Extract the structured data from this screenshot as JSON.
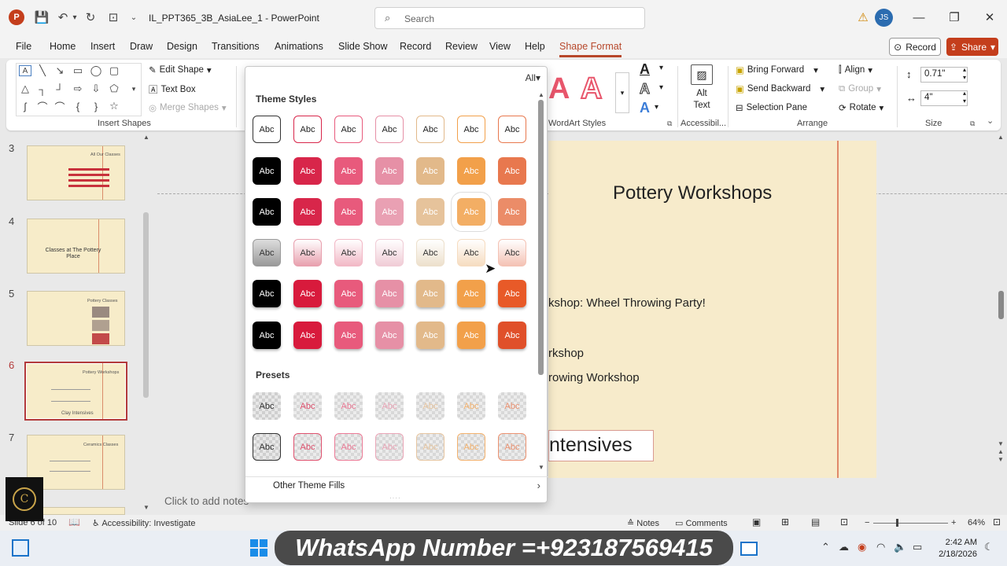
{
  "app": {
    "doc_title": "IL_PPT365_3B_AsiaLee_1",
    "app_name": "PowerPoint",
    "doc_title_sep": " - ",
    "search_placeholder": "Search",
    "user_initials": "JS"
  },
  "menu": {
    "items": [
      "File",
      "Home",
      "Insert",
      "Draw",
      "Design",
      "Transitions",
      "Animations",
      "Slide Show",
      "Record",
      "Review",
      "View",
      "Help",
      "Shape Format"
    ],
    "record": "Record",
    "share": "Share"
  },
  "ribbon": {
    "insert_shapes": "Insert Shapes",
    "edit_shape": "Edit Shape",
    "text_box": "Text Box",
    "merge_shapes": "Merge Shapes",
    "wordart_styles": "WordArt Styles",
    "alt_text_1": "Alt",
    "alt_text_2": "Text",
    "accessibility": "Accessibil...",
    "bring_forward": "Bring Forward",
    "send_backward": "Send Backward",
    "selection_pane": "Selection Pane",
    "align": "Align",
    "group": "Group",
    "rotate": "Rotate",
    "arrange": "Arrange",
    "height": "0.71\"",
    "width": "4\"",
    "size": "Size"
  },
  "gallery": {
    "filter": "All",
    "theme_styles": "Theme Styles",
    "swatch_label": "Abc",
    "presets": "Presets",
    "other_fills": "Other Theme Fills"
  },
  "thumbnails": {
    "s3": {
      "num": "3",
      "title": "All Our Classes"
    },
    "s4": {
      "num": "4",
      "title": "Classes at The Pottery Place"
    },
    "s5": {
      "num": "5",
      "title": "Pottery Classes"
    },
    "s6": {
      "num": "6",
      "title": "Pottery Workshops",
      "footer": "Clay Intensives"
    },
    "s7": {
      "num": "7",
      "title": "Ceramics Classes"
    }
  },
  "slide": {
    "title": "Pottery Workshops",
    "line1": "kshop: Wheel Throwing Party!",
    "line2": "rkshop",
    "line3": "rowing Workshop",
    "box": "ntensives"
  },
  "notes_placeholder": "Click to add notes",
  "status": {
    "slide_count": "Slide 6 of 10",
    "accessibility": "Accessibility: Investigate",
    "notes": "Notes",
    "comments": "Comments",
    "zoom": "64%"
  },
  "taskbar": {
    "banner": "WhatsApp Number =+923187569415",
    "time": "2:42 AM",
    "date": "2/18/2026"
  },
  "colors": {
    "accent": "#b7472a",
    "share": "#c43e1c",
    "slide_bg": "#f7ebcb"
  }
}
